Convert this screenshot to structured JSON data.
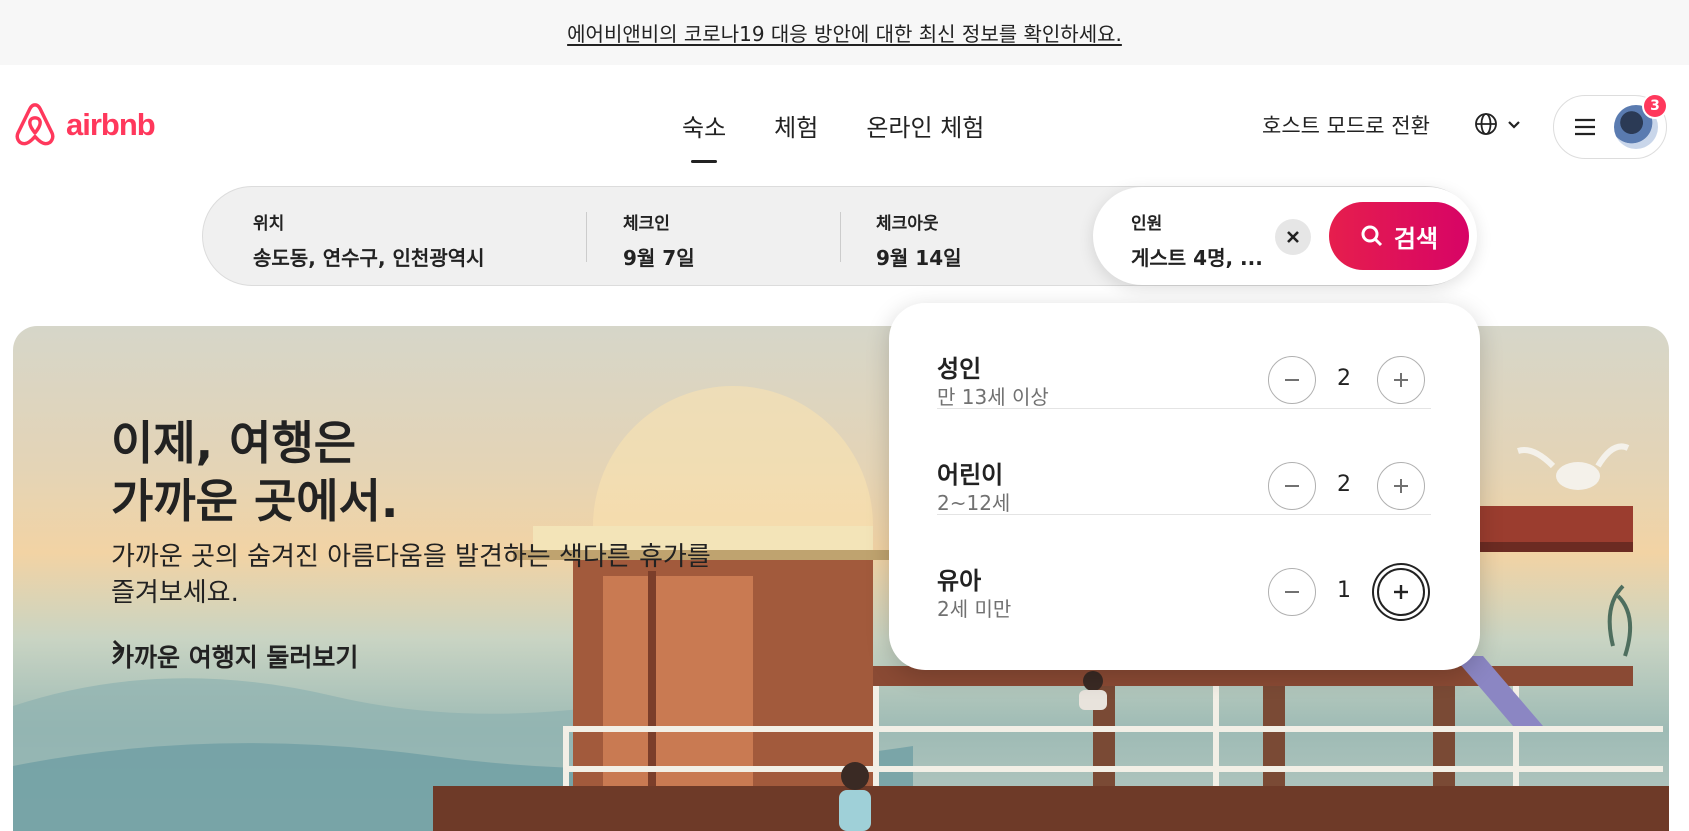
{
  "banner": {
    "text": "에어비앤비의 코로나19 대응 방안에 대한 최신 정보를 확인하세요."
  },
  "header": {
    "logo_text": "airbnb",
    "tabs": [
      {
        "label": "숙소",
        "active": true
      },
      {
        "label": "체험",
        "active": false
      },
      {
        "label": "온라인 체험",
        "active": false
      }
    ],
    "host_link": "호스트 모드로 전환",
    "notification_count": "3"
  },
  "search": {
    "location": {
      "label": "위치",
      "value": "송도동, 연수구, 인천광역시"
    },
    "checkin": {
      "label": "체크인",
      "value": "9월 7일"
    },
    "checkout": {
      "label": "체크아웃",
      "value": "9월 14일"
    },
    "guests": {
      "label": "인원",
      "value": "게스트 4명, ..."
    },
    "button_label": "검색"
  },
  "hero": {
    "title": "이제, 여행은\n가까운 곳에서.",
    "subtitle": "가까운 곳의 숨겨진 아름다움을 발견하는 색다른 휴가를 즐겨보세요.",
    "link": "가까운 여행지 둘러보기"
  },
  "guests_dropdown": {
    "rows": [
      {
        "label": "성인",
        "desc": "만 13세 이상",
        "count": "2"
      },
      {
        "label": "어린이",
        "desc": "2~12세",
        "count": "2"
      },
      {
        "label": "유아",
        "desc": "2세 미만",
        "count": "1"
      }
    ]
  },
  "colors": {
    "brand": "#FF385C",
    "search_button": "#E61E4D"
  }
}
